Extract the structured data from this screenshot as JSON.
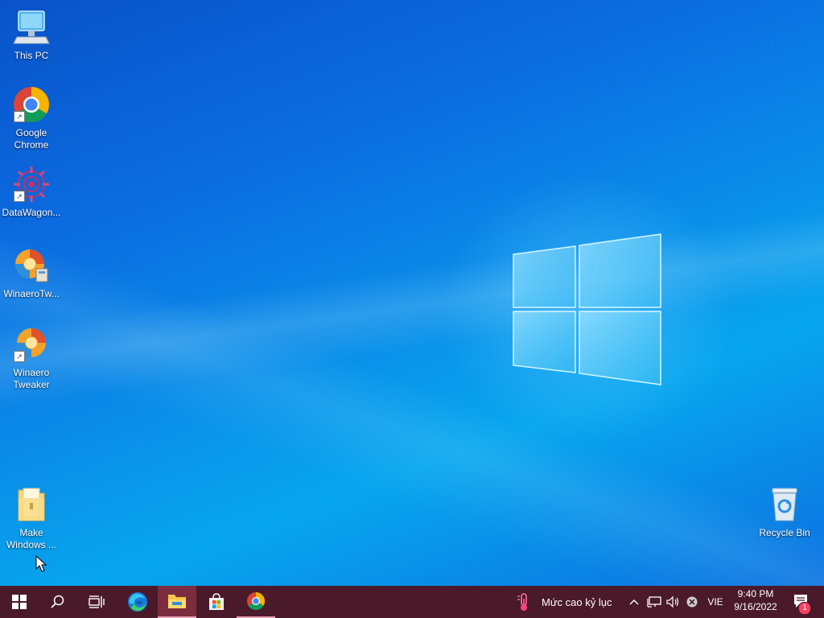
{
  "desktop": {
    "icons": [
      {
        "label": "This PC",
        "icon": "computer-icon"
      },
      {
        "label": "Google\nChrome",
        "icon": "chrome-icon"
      },
      {
        "label": "DataWagon...",
        "icon": "datawagon-icon"
      },
      {
        "label": "WinaeroTw...",
        "icon": "winaero-tweaker-icon"
      },
      {
        "label": "Winaero\nTweaker",
        "icon": "winaero-tweaker-icon"
      },
      {
        "label": "Make\nWindows ...",
        "icon": "folder-icon"
      },
      {
        "label": "Recycle Bin",
        "icon": "recycle-bin-icon"
      }
    ]
  },
  "taskbar": {
    "weather_text": "Mức cao kỷ lục",
    "language": "VIE",
    "time": "9:40 PM",
    "date": "9/16/2022",
    "notification_count": "1"
  },
  "colors": {
    "taskbar_bg": "#4a1a2a",
    "accent": "#e8a0b4"
  }
}
